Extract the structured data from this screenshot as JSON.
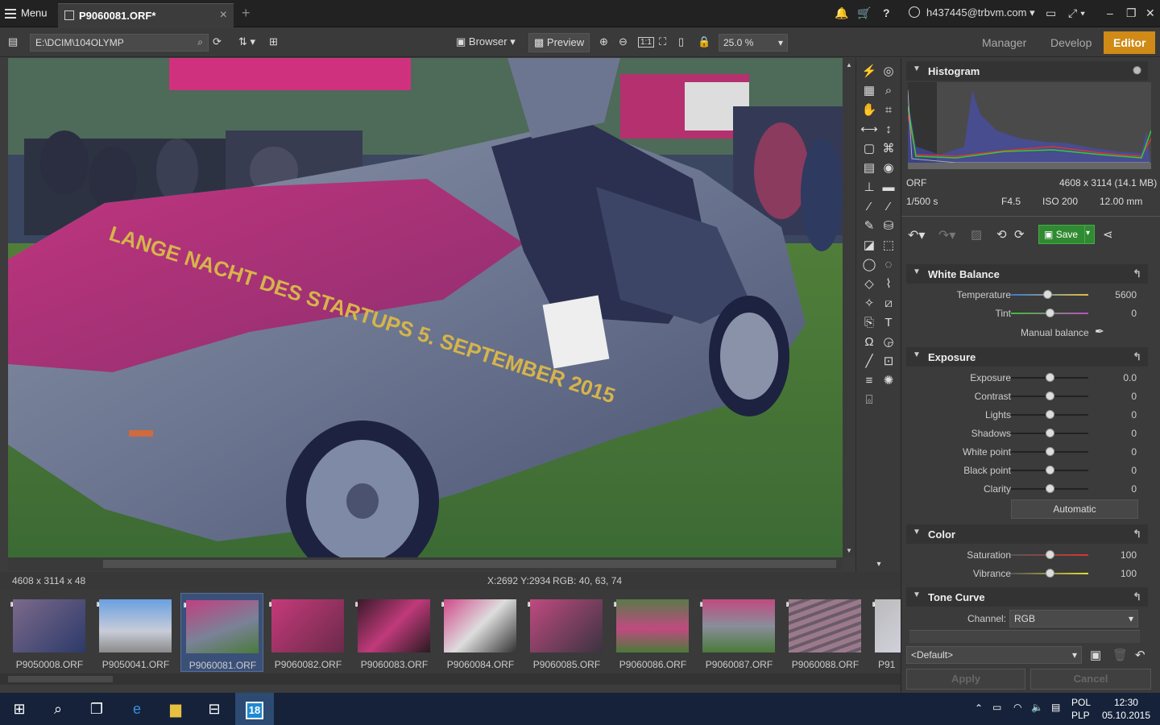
{
  "titlebar": {
    "menu_label": "Menu",
    "tab_title": "P9060081.ORF*",
    "new_tab": "+",
    "user": "h437445@trbvm.com",
    "icons": [
      "bell-icon",
      "cart-icon",
      "help-icon",
      "account-icon",
      "screen-icon",
      "expand-icon",
      "minimize-icon",
      "restore-icon",
      "close-icon"
    ]
  },
  "toolbar": {
    "path": "E:\\DCIM\\104OLYMP",
    "browser_label": "Browser",
    "preview_label": "Preview",
    "zoom": "25.0 %",
    "modes": [
      "Manager",
      "Develop",
      "Editor"
    ],
    "active_mode": "Editor",
    "accent_color": "#d08a16"
  },
  "status": {
    "dimensions": "4608 x 3114 x 48",
    "coords": "X:2692 Y:2934",
    "rgb": "RGB: 40, 63, 74"
  },
  "photo": {
    "sign_text": "LANGE NACHT DES STARTUPS 5. SEPTEMBER 2015"
  },
  "histogram": {
    "title": "Histogram",
    "format": "ORF",
    "size": "4608 x 3114 (14.1 MB)",
    "shutter": "1/500 s",
    "aperture": "F4.5",
    "iso": "ISO 200",
    "focal": "12.00 mm"
  },
  "actions": {
    "save_label": "Save"
  },
  "white_balance": {
    "title": "White Balance",
    "rows": [
      {
        "label": "Temperature",
        "value": "5600",
        "pos": 0.45
      },
      {
        "label": "Tint",
        "value": "0",
        "pos": 0.5
      }
    ],
    "manual_label": "Manual balance"
  },
  "exposure": {
    "title": "Exposure",
    "rows": [
      {
        "label": "Exposure",
        "value": "0.0",
        "pos": 0.5
      },
      {
        "label": "Contrast",
        "value": "0",
        "pos": 0.5
      },
      {
        "label": "Lights",
        "value": "0",
        "pos": 0.5
      },
      {
        "label": "Shadows",
        "value": "0",
        "pos": 0.5
      },
      {
        "label": "White point",
        "value": "0",
        "pos": 0.5
      },
      {
        "label": "Black point",
        "value": "0",
        "pos": 0.5
      },
      {
        "label": "Clarity",
        "value": "0",
        "pos": 0.5
      }
    ],
    "auto_label": "Automatic"
  },
  "color": {
    "title": "Color",
    "rows": [
      {
        "label": "Saturation",
        "value": "100",
        "pos": 0.5
      },
      {
        "label": "Vibrance",
        "value": "100",
        "pos": 0.5
      }
    ]
  },
  "tone_curve": {
    "title": "Tone Curve",
    "channel_label": "Channel:",
    "channel_value": "RGB"
  },
  "preset": {
    "value": "<Default>",
    "apply_label": "Apply",
    "cancel_label": "Cancel"
  },
  "filmstrip": [
    {
      "name": "P9050008.ORF"
    },
    {
      "name": "P9050041.ORF"
    },
    {
      "name": "P9060081.ORF",
      "selected": true
    },
    {
      "name": "P9060082.ORF"
    },
    {
      "name": "P9060083.ORF"
    },
    {
      "name": "P9060084.ORF"
    },
    {
      "name": "P9060085.ORF"
    },
    {
      "name": "P9060086.ORF"
    },
    {
      "name": "P9060087.ORF"
    },
    {
      "name": "P9060088.ORF"
    },
    {
      "name": "P91"
    }
  ],
  "taskbar": {
    "lang_top": "POL",
    "lang_bottom": "PLP",
    "time": "12:30",
    "date": "05.10.2015",
    "app_badge": "18"
  }
}
